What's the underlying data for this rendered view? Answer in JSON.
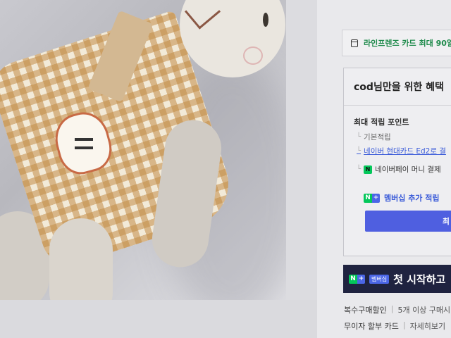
{
  "product_image": {
    "alt_icon": "plush-bunny-photo"
  },
  "promo": {
    "icon": "credit-card-icon",
    "text": "라인프렌즈 카드 최대 90일"
  },
  "benefit_box": {
    "title": "cod님만을 위한 혜택",
    "points_heading": "최대 적립 포인트",
    "items": [
      {
        "label": "기본적립"
      },
      {
        "label": "네이버 현대카드 Ed2로 결"
      },
      {
        "label": "네이버페이 머니 결제"
      }
    ],
    "npay_badge": "N",
    "membership": {
      "n": "N",
      "plus": "+",
      "label": "멤버십 추가 적립"
    },
    "max_button_label": "최"
  },
  "banner": {
    "n": "N",
    "plus": "+",
    "tag": "멤버십",
    "text": "첫 시작하고"
  },
  "info": {
    "rows": [
      {
        "label": "복수구매할인",
        "value": "5개 이상 구매시"
      },
      {
        "label": "무이자 할부 카드",
        "value": "자세히보기"
      }
    ]
  },
  "colors": {
    "accent_green": "#03c75a",
    "accent_blue": "#4f5fe0",
    "banner_bg": "#1f2340",
    "link_blue": "#3a5bd9"
  }
}
